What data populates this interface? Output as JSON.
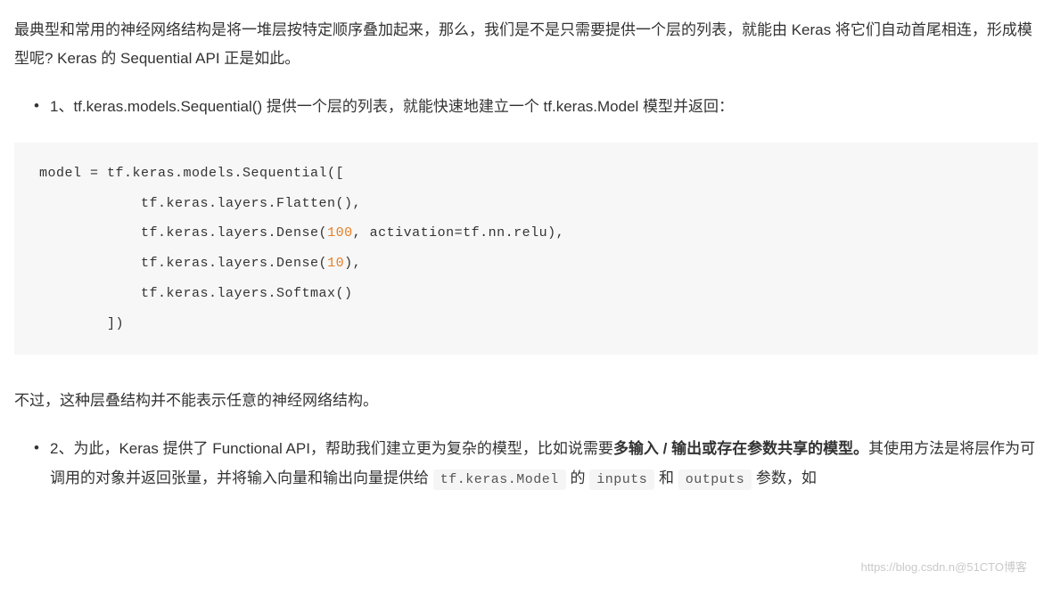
{
  "para1": "最典型和常用的神经网络结构是将一堆层按特定顺序叠加起来，那么，我们是不是只需要提供一个层的列表，就能由 Keras 将它们自动首尾相连，形成模型呢? Keras 的 Sequential API 正是如此。",
  "bullet1": "1、tf.keras.models.Sequential() 提供一个层的列表，就能快速地建立一个 tf.keras.Model 模型并返回：",
  "code": {
    "l1": "model = tf.keras.models.Sequential([",
    "l2a": "            tf.keras.layers.Flatten(),",
    "l3a": "            tf.keras.layers.Dense(",
    "l3n": "100",
    "l3b": ", activation=tf.nn.relu),",
    "l4a": "            tf.keras.layers.Dense(",
    "l4n": "10",
    "l4b": "),",
    "l5a": "            tf.keras.layers.Softmax()",
    "l6": "        ])"
  },
  "para2": "不过，这种层叠结构并不能表示任意的神经网络结构。",
  "bullet2": {
    "a": "2、为此，Keras 提供了 Functional API，帮助我们建立更为复杂的模型，比如说需要",
    "b": "多输入 / 输出或存在参数共享的模型。",
    "c": "其使用方法是将层作为可调用的对象并返回张量，并将输入向量和输出向量提供给 ",
    "code1": "tf.keras.Model",
    "d": " 的 ",
    "code2": "inputs",
    "e": " 和 ",
    "code3": "outputs",
    "f": " 参数，如"
  },
  "watermark": "https://blog.csdn.n@51CTO博客"
}
